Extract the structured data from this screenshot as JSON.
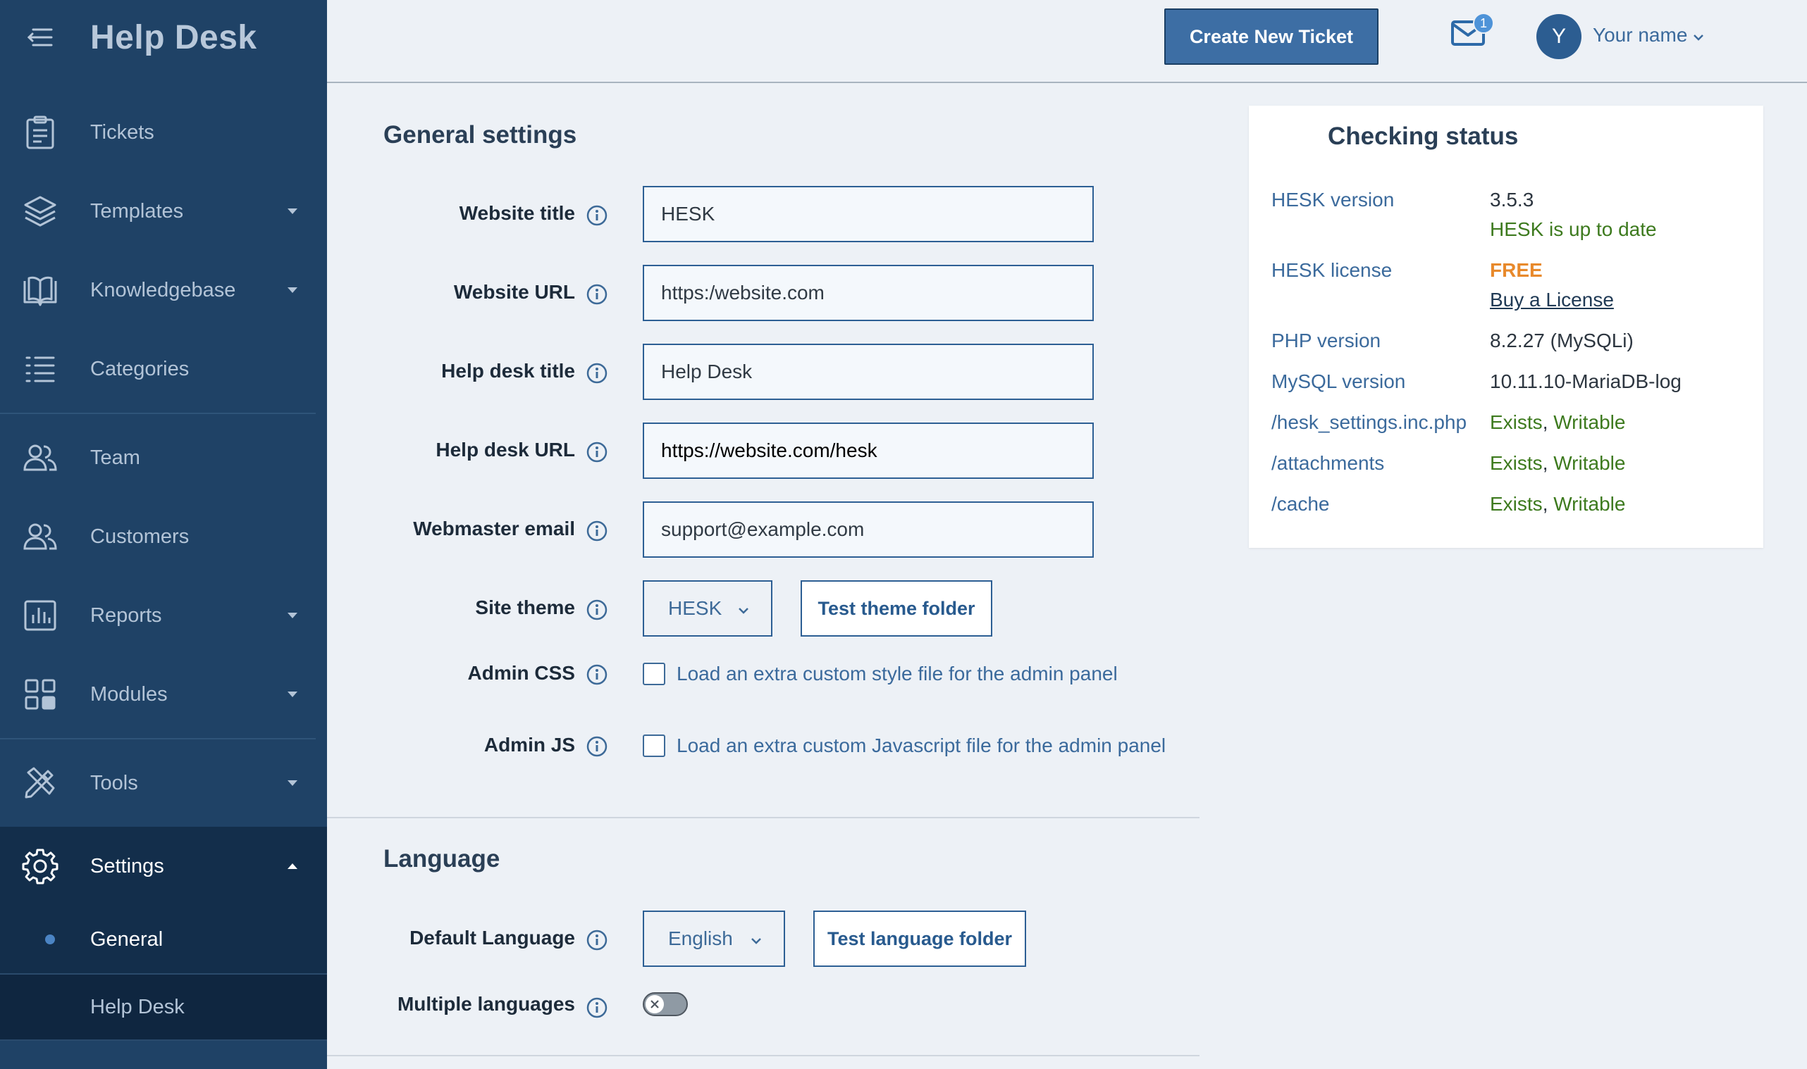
{
  "sidebar": {
    "title": "Help Desk",
    "items": [
      {
        "label": "Tickets"
      },
      {
        "label": "Templates"
      },
      {
        "label": "Knowledgebase"
      },
      {
        "label": "Categories"
      },
      {
        "label": "Team"
      },
      {
        "label": "Customers"
      },
      {
        "label": "Reports"
      },
      {
        "label": "Modules"
      },
      {
        "label": "Tools"
      },
      {
        "label": "Settings"
      }
    ],
    "sub_items": [
      {
        "label": "General"
      },
      {
        "label": "Help Desk"
      }
    ]
  },
  "topbar": {
    "create_button": "Create New Ticket",
    "mail_badge": "1",
    "avatar_initial": "Y",
    "user_name": "Your name"
  },
  "general": {
    "title": "General settings",
    "website_title_label": "Website title",
    "website_title_value": "HESK",
    "website_url_label": "Website URL",
    "website_url_value": "https:/website.com",
    "helpdesk_title_label": "Help desk title",
    "helpdesk_title_value": "Help Desk",
    "helpdesk_url_label": "Help desk URL",
    "helpdesk_url_value": "https://website.com/hesk",
    "webmaster_email_label": "Webmaster email",
    "webmaster_email_value": "support@example.com",
    "site_theme_label": "Site theme",
    "site_theme_value": "HESK",
    "test_theme_button": "Test theme folder",
    "admin_css_label": "Admin CSS",
    "admin_css_text": "Load an extra custom style file for the admin panel",
    "admin_js_label": "Admin JS",
    "admin_js_text": "Load an extra custom Javascript file for the admin panel"
  },
  "language": {
    "title": "Language",
    "default_language_label": "Default Language",
    "default_language_value": "English",
    "test_language_button": "Test language folder",
    "multiple_languages_label": "Multiple languages"
  },
  "status": {
    "title": "Checking status",
    "hesk_version_label": "HESK version",
    "hesk_version_value": "3.5.3",
    "hesk_uptodate": "HESK is up to date",
    "hesk_license_label": "HESK license",
    "hesk_license_value": "FREE",
    "buy_license": "Buy a License",
    "php_version_label": "PHP version",
    "php_version_value": "8.2.27 (MySQLi)",
    "mysql_version_label": "MySQL version",
    "mysql_version_value": "10.11.10-MariaDB-log",
    "settings_file_label": "/hesk_settings.inc.php",
    "attachments_label": "/attachments",
    "cache_label": "/cache",
    "exists": "Exists",
    "comma": ",",
    "writable": "Writable"
  },
  "colors": {
    "sidebar_bg": "#1f4266",
    "sidebar_active": "#132e4b",
    "accent": "#3d6ea4",
    "success": "#3d7a1e",
    "warning": "#e8892b"
  }
}
